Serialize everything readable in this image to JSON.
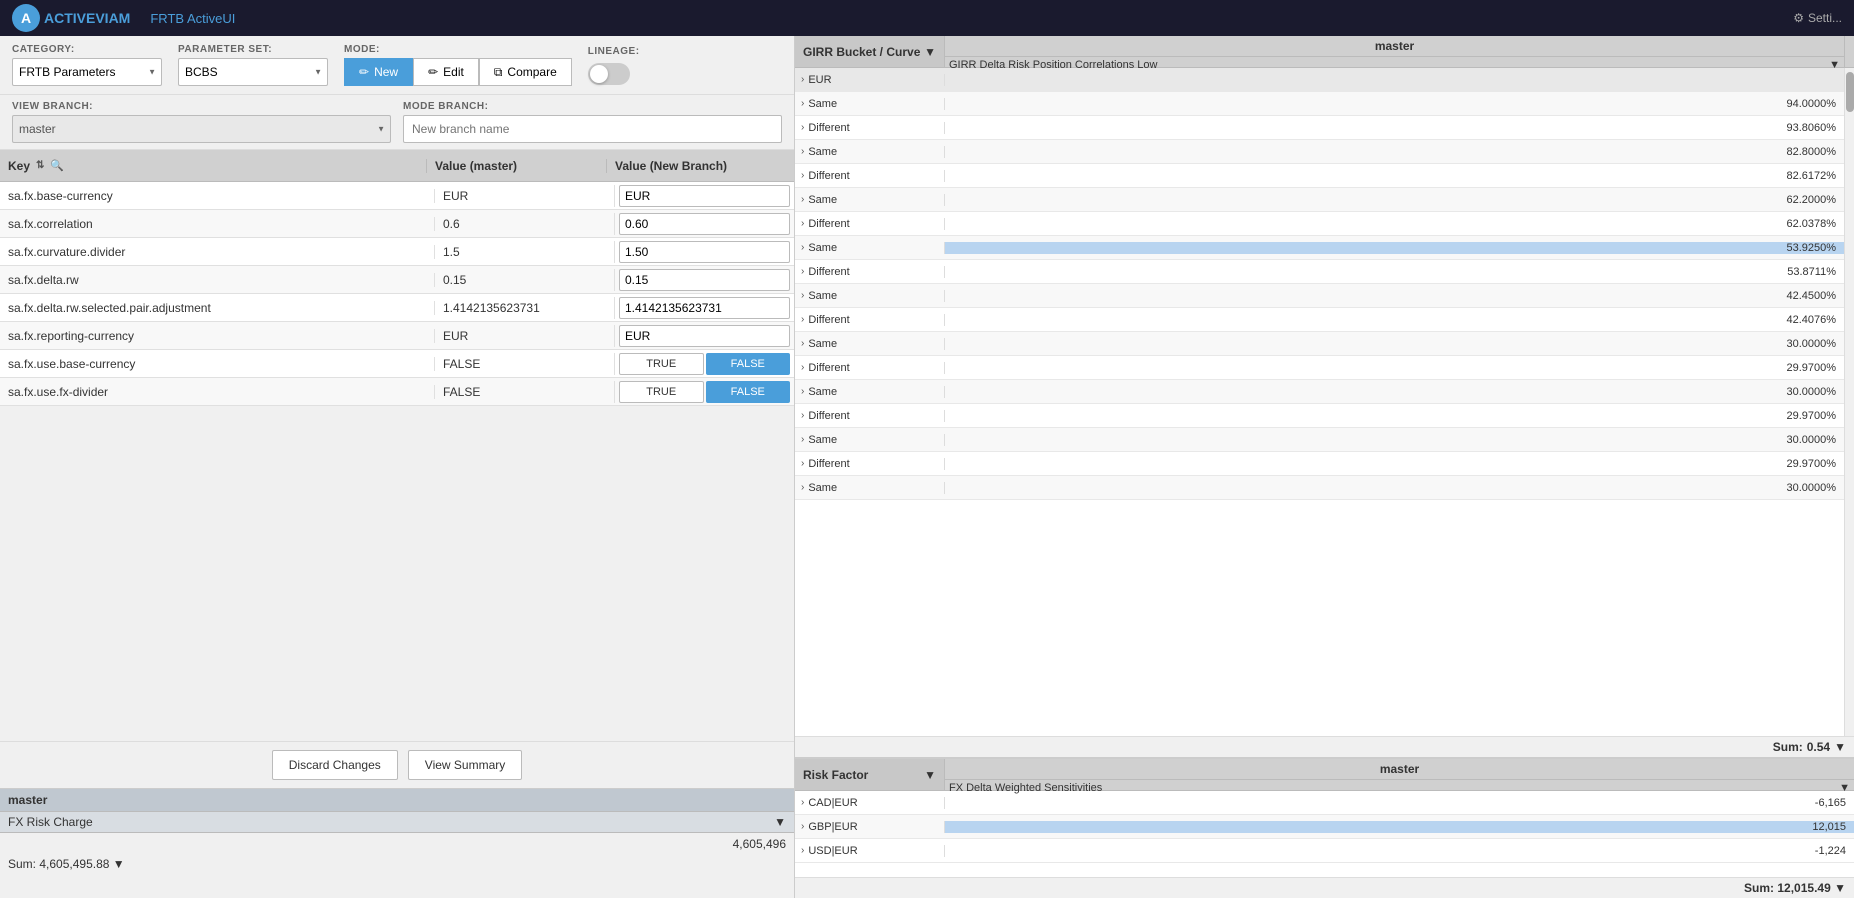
{
  "header": {
    "logo_letter": "A",
    "logo_text_1": "ACTIVE",
    "logo_text_2": "VIAM",
    "app_title": "FRTB ActiveUI",
    "settings_label": "Setti..."
  },
  "controls": {
    "category_label": "CATEGORY:",
    "category_value": "FRTB Parameters",
    "parameter_set_label": "PARAMETER SET:",
    "parameter_set_value": "BCBS",
    "mode_label": "MODE:",
    "mode_new": "New",
    "mode_edit": "Edit",
    "mode_compare": "Compare",
    "lineage_label": "LINEAGE:"
  },
  "branch": {
    "view_label": "VIEW BRANCH:",
    "view_value": "master",
    "mode_label": "MODE BRANCH:",
    "mode_placeholder": "New branch name"
  },
  "table": {
    "col_key": "Key",
    "col_value": "Value (master)",
    "col_new_value": "Value (New Branch)",
    "rows": [
      {
        "key": "sa.fx.base-currency",
        "value": "EUR",
        "new_value": "EUR",
        "type": "text"
      },
      {
        "key": "sa.fx.correlation",
        "value": "0.6",
        "new_value": "0.60",
        "type": "text"
      },
      {
        "key": "sa.fx.curvature.divider",
        "value": "1.5",
        "new_value": "1.50",
        "type": "text"
      },
      {
        "key": "sa.fx.delta.rw",
        "value": "0.15",
        "new_value": "0.15",
        "type": "text"
      },
      {
        "key": "sa.fx.delta.rw.selected.pair.adjustment",
        "value": "1.4142135623731",
        "new_value": "1.4142135623731",
        "type": "text"
      },
      {
        "key": "sa.fx.reporting-currency",
        "value": "EUR",
        "new_value": "EUR",
        "type": "text"
      },
      {
        "key": "sa.fx.use.base-currency",
        "value": "FALSE",
        "new_value": "",
        "type": "bool",
        "bool_state": "FALSE"
      },
      {
        "key": "sa.fx.use.fx-divider",
        "value": "FALSE",
        "new_value": "",
        "type": "bool",
        "bool_state": "FALSE"
      }
    ]
  },
  "actions": {
    "discard_label": "Discard Changes",
    "view_summary_label": "View Summary"
  },
  "bottom_left": {
    "header": "master",
    "dropdown": "FX Risk Charge",
    "value": "4,605,496",
    "sum_label": "Sum:",
    "sum_value": "4,605,495.88"
  },
  "top_right": {
    "col_bucket": "GIRR Bucket / Curve",
    "col_master": "master",
    "col_sub": "GIRR Delta Risk Position Correlations Low",
    "rows": [
      {
        "bucket": "EUR",
        "colspan": true,
        "value": null
      },
      {
        "bucket": "Same",
        "value": "94.0000%",
        "highlighted": false
      },
      {
        "bucket": "Different",
        "value": "93.8060%",
        "highlighted": false
      },
      {
        "bucket": "Same",
        "value": "82.8000%",
        "highlighted": false
      },
      {
        "bucket": "Different",
        "value": "82.6172%",
        "highlighted": false
      },
      {
        "bucket": "Same",
        "value": "62.2000%",
        "highlighted": false
      },
      {
        "bucket": "Different",
        "value": "62.0378%",
        "highlighted": false
      },
      {
        "bucket": "Same",
        "value": "53.9250%",
        "highlighted": true
      },
      {
        "bucket": "Different",
        "value": "53.8711%",
        "highlighted": false
      },
      {
        "bucket": "Same",
        "value": "42.4500%",
        "highlighted": false
      },
      {
        "bucket": "Different",
        "value": "42.4076%",
        "highlighted": false
      },
      {
        "bucket": "Same",
        "value": "30.0000%",
        "highlighted": false
      },
      {
        "bucket": "Different",
        "value": "29.9700%",
        "highlighted": false
      },
      {
        "bucket": "Same",
        "value": "30.0000%",
        "highlighted": false
      },
      {
        "bucket": "Different",
        "value": "29.9700%",
        "highlighted": false
      },
      {
        "bucket": "Same",
        "value": "30.0000%",
        "highlighted": false
      },
      {
        "bucket": "Different",
        "value": "29.9700%",
        "highlighted": false
      },
      {
        "bucket": "Same",
        "value": "30.0000%",
        "highlighted": false
      }
    ],
    "sum_label": "Sum:",
    "sum_value": "0.54"
  },
  "bottom_right": {
    "col_risk": "Risk Factor",
    "col_master": "master",
    "col_sub": "FX Delta Weighted Sensitivities",
    "rows": [
      {
        "risk": "CAD|EUR",
        "value": "-6,165",
        "highlighted": false
      },
      {
        "risk": "GBP|EUR",
        "value": "12,015",
        "highlighted": true
      },
      {
        "risk": "USD|EUR",
        "value": "-1,224",
        "highlighted": false
      }
    ],
    "sum_label": "Sum:",
    "sum_value": "12,015.49"
  }
}
